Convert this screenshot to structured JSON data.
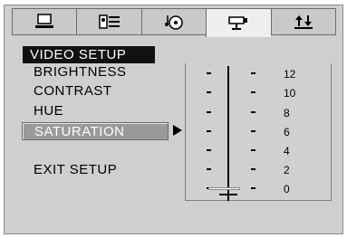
{
  "tabs": [
    {
      "icon": "monitor-icon",
      "active": false
    },
    {
      "icon": "speaker-panel-icon",
      "active": false
    },
    {
      "icon": "music-disc-icon",
      "active": false
    },
    {
      "icon": "video-camera-icon",
      "active": true
    },
    {
      "icon": "sort-arrows-icon",
      "active": false
    }
  ],
  "section_title": "VIDEO SETUP",
  "menu": {
    "brightness": "BRIGHTNESS",
    "contrast": "CONTRAST",
    "hue": "HUE",
    "saturation": "SATURATION",
    "exit": "EXIT SETUP"
  },
  "scale": {
    "labels": [
      "12",
      "10",
      "8",
      "6",
      "4",
      "2",
      "0"
    ],
    "current_value": 0
  }
}
